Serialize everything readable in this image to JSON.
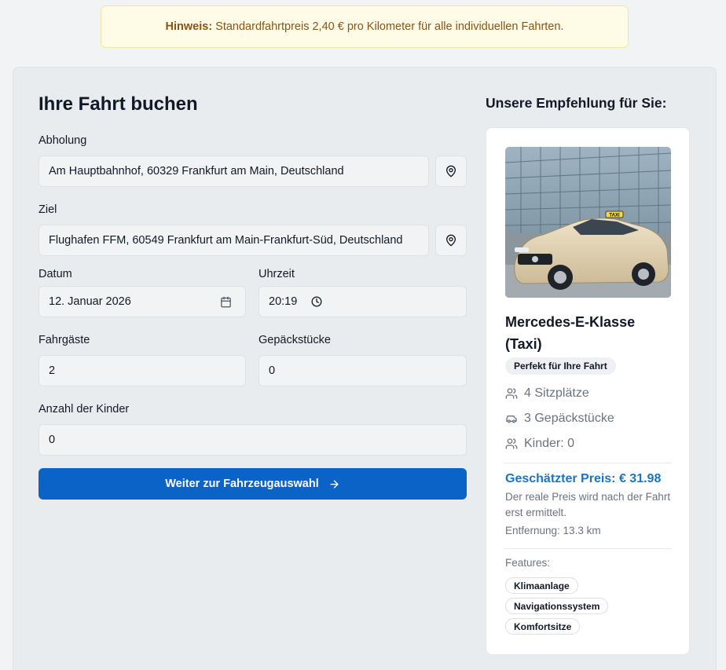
{
  "notice": {
    "bold": "Hinweis:",
    "text": "Standardfahrtpreis 2,40 € pro Kilometer für alle individuellen Fahrten."
  },
  "form": {
    "title": "Ihre Fahrt buchen",
    "pickup_label": "Abholung",
    "pickup_value": "Am Hauptbahnhof, 60329 Frankfurt am Main, Deutschland",
    "destination_label": "Ziel",
    "destination_value": "Flughafen FFM, 60549 Frankfurt am Main-Frankfurt-Süd, Deutschland",
    "date_label": "Datum",
    "date_value": "12. Januar 2026",
    "time_label": "Uhrzeit",
    "time_value": "20:19",
    "passengers_label": "Fahrgäste",
    "passengers_value": "2",
    "luggage_label": "Gepäckstücke",
    "luggage_value": "0",
    "children_label": "Anzahl der Kinder",
    "children_value": "0",
    "submit_label": "Weiter zur Fahrzeugauswahl"
  },
  "recommendation": {
    "heading": "Unsere Empfehlung für Sie:",
    "car_name": "Mercedes-E-Klasse (Taxi)",
    "badge": "Perfekt für Ihre Fahrt",
    "seats": "4 Sitzplätze",
    "luggage": "3 Gepäckstücke",
    "children": "Kinder: 0",
    "price": "Geschätzter Preis: € 31.98",
    "price_note": "Der reale Preis wird nach der Fahrt erst ermittelt.",
    "distance": "Entfernung: 13.3 km",
    "features_label": "Features:",
    "features": [
      "Klimaanlage",
      "Navigationssystem",
      "Komfortsitze"
    ],
    "taxi_sign": "TAXI"
  },
  "colors": {
    "primary": "#0b63c7",
    "price": "#1b74c4",
    "notice_bg": "#fefbe6",
    "notice_text": "#8a5415"
  }
}
